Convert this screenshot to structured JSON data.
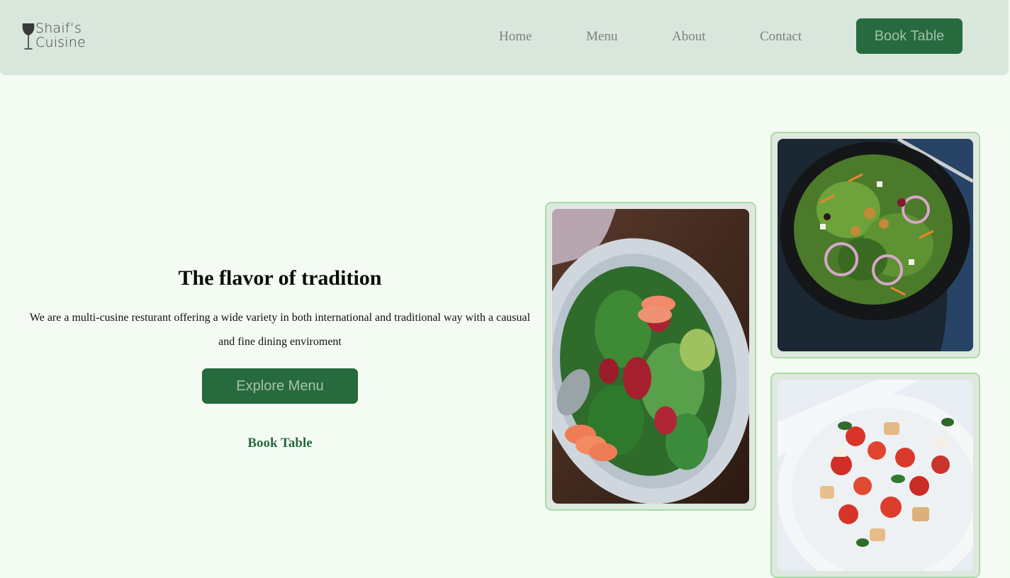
{
  "brand": {
    "line1": "Shaif’s",
    "line2": "Cuisine",
    "icon": "wine-glass-icon"
  },
  "nav": {
    "home": "Home",
    "menu": "Menu",
    "about": "About",
    "contact": "Contact",
    "book_button": "Book Table"
  },
  "hero": {
    "title": "The flavor of tradition",
    "description": "We are a multi-cusine resturant offering a wide variety in both international and traditional way with a causual and fine dining enviroment",
    "explore_button": "Explore Menu",
    "book_link": "Book Table"
  },
  "gallery": {
    "images": [
      "salad-pomegranate-avocado-photo",
      "green-salad-dark-bowl-photo",
      "tomato-bread-salad-photo"
    ]
  },
  "colors": {
    "header_bg": "#d9e6dc",
    "page_bg": "#f3fbf3",
    "accent_green": "#276a3e",
    "card_border": "#a9dca8"
  }
}
